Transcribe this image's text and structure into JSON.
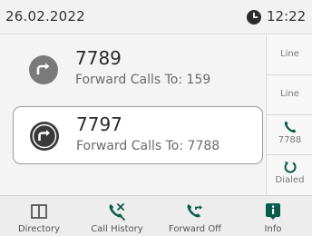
{
  "status_bar": {
    "date": "26.02.2022",
    "time": "12:22",
    "clock_icon": "clock-icon"
  },
  "calls": [
    {
      "number": "7789",
      "detail": "Forward Calls To: 159",
      "selected": false
    },
    {
      "number": "7797",
      "detail": "Forward Calls To: 7788",
      "selected": true
    }
  ],
  "line_keys": [
    {
      "label": "Line"
    },
    {
      "label": "Line"
    },
    {
      "label": "7788",
      "icon": "phone-handset-icon"
    },
    {
      "label": "Dialed",
      "icon": "redial-icon"
    }
  ],
  "softkeys": [
    {
      "label": "Directory",
      "icon": "book-icon"
    },
    {
      "label": "Call History",
      "icon": "call-history-icon"
    },
    {
      "label": "Forward Off",
      "icon": "call-forward-icon"
    },
    {
      "label": "Info",
      "icon": "info-icon"
    }
  ],
  "colors": {
    "accent": "#0a5c4a",
    "avatar_inactive": "#7a7a7a",
    "avatar_active": "#3a3a3a"
  }
}
